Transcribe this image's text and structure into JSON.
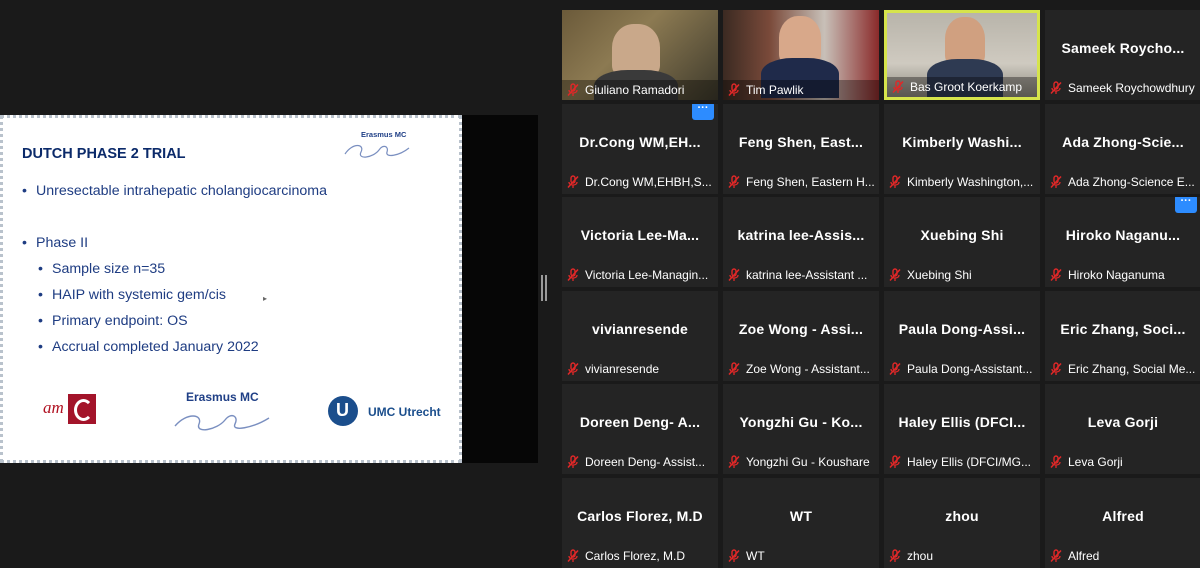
{
  "slide": {
    "title": "DUTCH PHASE 2 TRIAL",
    "logo_top_text": "Erasmus MC",
    "bullets": [
      "Unresectable intrahepatic cholangiocarcinoma",
      "Phase II"
    ],
    "sub_bullets": [
      "Sample size n=35",
      "HAIP with systemic gem/cis",
      "Primary endpoint: OS",
      "Accrual completed January 2022"
    ],
    "logos": {
      "amc": "am",
      "erasmus": "Erasmus MC",
      "umc": "UMC Utrecht"
    }
  },
  "gallery": {
    "video_tiles": [
      {
        "name": "Giuliano Ramadori"
      },
      {
        "name": "Tim Pawlik"
      },
      {
        "name": "Bas Groot Koerkamp"
      }
    ],
    "tiles": [
      {
        "big": "Sameek  Roycho...",
        "name": "Sameek Roychowdhury"
      },
      {
        "big": "Dr.Cong  WM,EH...",
        "name": "Dr.Cong WM,EHBH,S..."
      },
      {
        "big": "Feng  Shen,  East...",
        "name": "Feng Shen, Eastern H..."
      },
      {
        "big": "Kimberly  Washi...",
        "name": "Kimberly Washington,..."
      },
      {
        "big": "Ada  Zhong-Scie...",
        "name": "Ada Zhong-Science E..."
      },
      {
        "big": "Victoria  Lee-Ma...",
        "name": "Victoria Lee-Managin..."
      },
      {
        "big": "katrina  lee-Assis...",
        "name": "katrina lee-Assistant ..."
      },
      {
        "big": "Xuebing Shi",
        "name": "Xuebing Shi"
      },
      {
        "big": "Hiroko  Naganu...",
        "name": "Hiroko Naganuma"
      },
      {
        "big": "vivianresende",
        "name": "vivianresende"
      },
      {
        "big": "Zoe  Wong  -  Assi...",
        "name": "Zoe Wong - Assistant..."
      },
      {
        "big": "Paula  Dong-Assi...",
        "name": "Paula Dong-Assistant..."
      },
      {
        "big": "Eric  Zhang,  Soci...",
        "name": "Eric Zhang, Social Me..."
      },
      {
        "big": "Doreen  Deng-  A...",
        "name": "Doreen Deng- Assist..."
      },
      {
        "big": "Yongzhi  Gu  -  Ko...",
        "name": "Yongzhi Gu - Koushare"
      },
      {
        "big": "Haley  Ellis  (DFCI...",
        "name": "Haley Ellis (DFCI/MG..."
      },
      {
        "big": "Leva Gorji",
        "name": "Leva Gorji"
      },
      {
        "big": "Carlos Florez, M.D",
        "name": "Carlos Florez, M.D"
      },
      {
        "big": "WT",
        "name": "WT"
      },
      {
        "big": "zhou",
        "name": "zhou"
      },
      {
        "big": "Alfred",
        "name": "Alfred"
      }
    ],
    "more_button": "···",
    "colors": {
      "muted_mic": "#e02828",
      "active_border": "#d6e44c",
      "tile_bg": "#242424",
      "more_button": "#2d8cff"
    }
  }
}
